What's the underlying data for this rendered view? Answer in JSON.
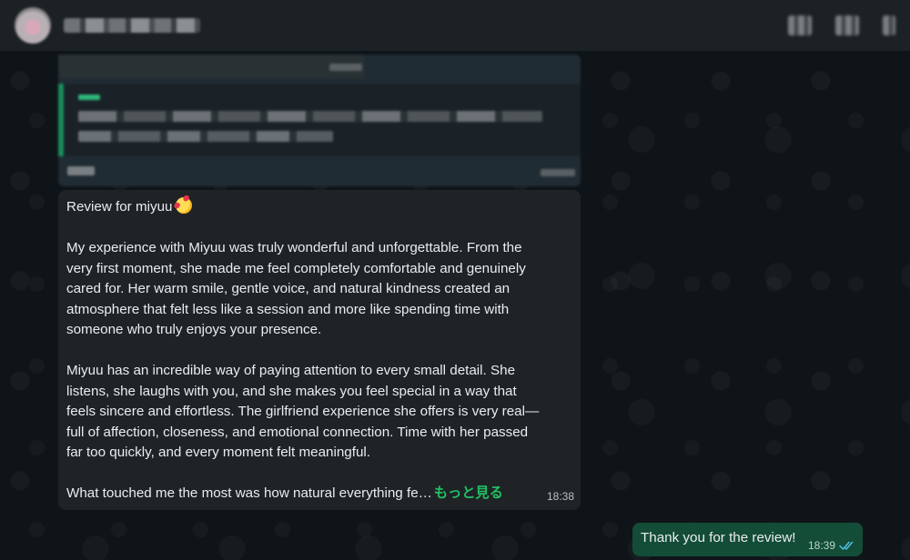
{
  "header": {
    "contact_name": "",
    "actions": [
      "video-call-icon",
      "search-icon",
      "menu-icon"
    ]
  },
  "quoted": {
    "note": ""
  },
  "message_in": {
    "title": "Review for miyuu",
    "emoji": "smiling-face-with-hearts",
    "paragraph1": [
      "My experience with Miyuu was truly wonderful and unforgettable. From the",
      "very first moment, she made me feel completely comfortable and genuinely",
      "cared for. Her warm smile, gentle voice, and natural kindness created an",
      "atmosphere that felt less like a session and more like spending time with",
      "someone who truly enjoys your presence."
    ],
    "paragraph2": [
      "Miyuu has an incredible way of paying attention to every small detail. She",
      "listens, she laughs with you, and she makes you feel special in a way that",
      "feels sincere and effortless. The girlfriend experience she offers is very real—",
      "full of affection, closeness, and emotional connection. Time with her passed",
      "far too quickly, and every moment felt meaningful."
    ],
    "last_line": "What touched me the most was how natural everything fe…",
    "read_more": "もっと見る",
    "time": "18:38"
  },
  "message_out": {
    "text": "Thank you for the review!",
    "time": "18:39",
    "status": "read",
    "status_color": "#53bdeb"
  },
  "colors": {
    "incoming_bubble": "#1f2326",
    "outgoing_bubble": "#144d37",
    "accent": "#21c063"
  }
}
